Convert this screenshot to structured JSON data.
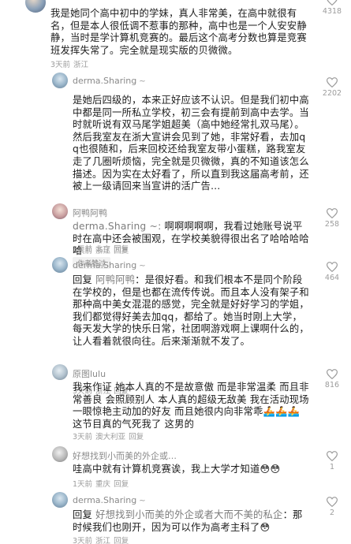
{
  "comments": [
    {
      "id": "c1",
      "username": "",
      "text": "我是她同个高中初中的学妹，真人非常美，在高中就很有名，但是本人很低调不惹事的那种，高中也是一个人安安静静，当时是学计算机竞赛的。最后这个高考分数也算是竞赛班发挥失常了。完全就是现实版的贝微微。",
      "meta": [
        "3天前",
        "浙江"
      ],
      "likes": "4318"
    },
    {
      "id": "c2",
      "username": "derma.Sharing",
      "text": "是她后四级的，本来正好应该不认识。但是我们初中高中都是同一所私立学校，初三会有提前到高中去学。当时就听说有双马尾学姐超美（高中她经常扎双马尾）。然后我室友在浙大宣讲会见到了她，非常好看，去加qq也很随和，后来回校还给我室友带小蛋糕，路我室友走了几圈听烦恼，完全就是贝微微，真的不知道该怎么描述。因为实在太好看了，所以直到我这届高考前，还被上一级请回来当宣讲的活广告…",
      "meta": [
        "3天前",
        "浙江",
        "回复"
      ],
      "author_liked": "作者赞过",
      "likes": "2202"
    },
    {
      "id": "c3",
      "username": "阿鸭阿鸭",
      "reply_to": "derma.Sharing",
      "text": "啊啊啊啊啊，我看过她账号说平时在高中还会被围观，在学校美貌得很出名了哈哈哈哈哈",
      "meta": [
        "3天前",
        "北京",
        "回复"
      ],
      "likes": "258"
    },
    {
      "id": "c4",
      "username": "derma.Sharing",
      "reply_prefix": "回复",
      "reply_to": "阿鸭阿鸭",
      "text": "：是很好看。和我们根本不是同个阶段在学校的，但是也都在流传传说。而且本人没有架子和那种高中美女混混的感觉，完全就是好好学习的学姐，我们都觉得好美去加qq，都给了。她当时刚上大学，每天发大学的快乐日常，社团啊游戏啊上课啊什么的，让人看着就很向往。后来渐渐就不发了。",
      "meta": [
        "3天前",
        "浙江",
        "回复"
      ],
      "likes": "464"
    },
    {
      "id": "c5",
      "username": "原图lulu",
      "text": "我来作证 她本人真的不是故意傲 而是非常温柔 而且非常善良 会照顾别人 本人真的超级无敌美 我在活动现场一眼惊艳主动加的好友 而且她很内向非常乖🚣🚣🚣 这节目真的气死我了 这男的",
      "meta": [
        "3天前",
        "澳大利亚",
        "回复"
      ],
      "likes": "816"
    },
    {
      "id": "c6",
      "username": "好想找到小而美的外企或…",
      "text": "哇高中就有计算机竞赛诶，我上大学才知道😳😳",
      "meta": [
        "1天前",
        "重庆",
        "回复"
      ],
      "likes": "1"
    },
    {
      "id": "c7",
      "username": "derma.Sharing",
      "reply_prefix": "回复",
      "reply_to": "好想找到小而美的外企或者大而不美的私企",
      "text": "：那时候我们也刚开，因为可以作为高考主科了😳",
      "meta": [
        "3天前",
        "浙江",
        "回复"
      ],
      "likes": "2"
    }
  ]
}
